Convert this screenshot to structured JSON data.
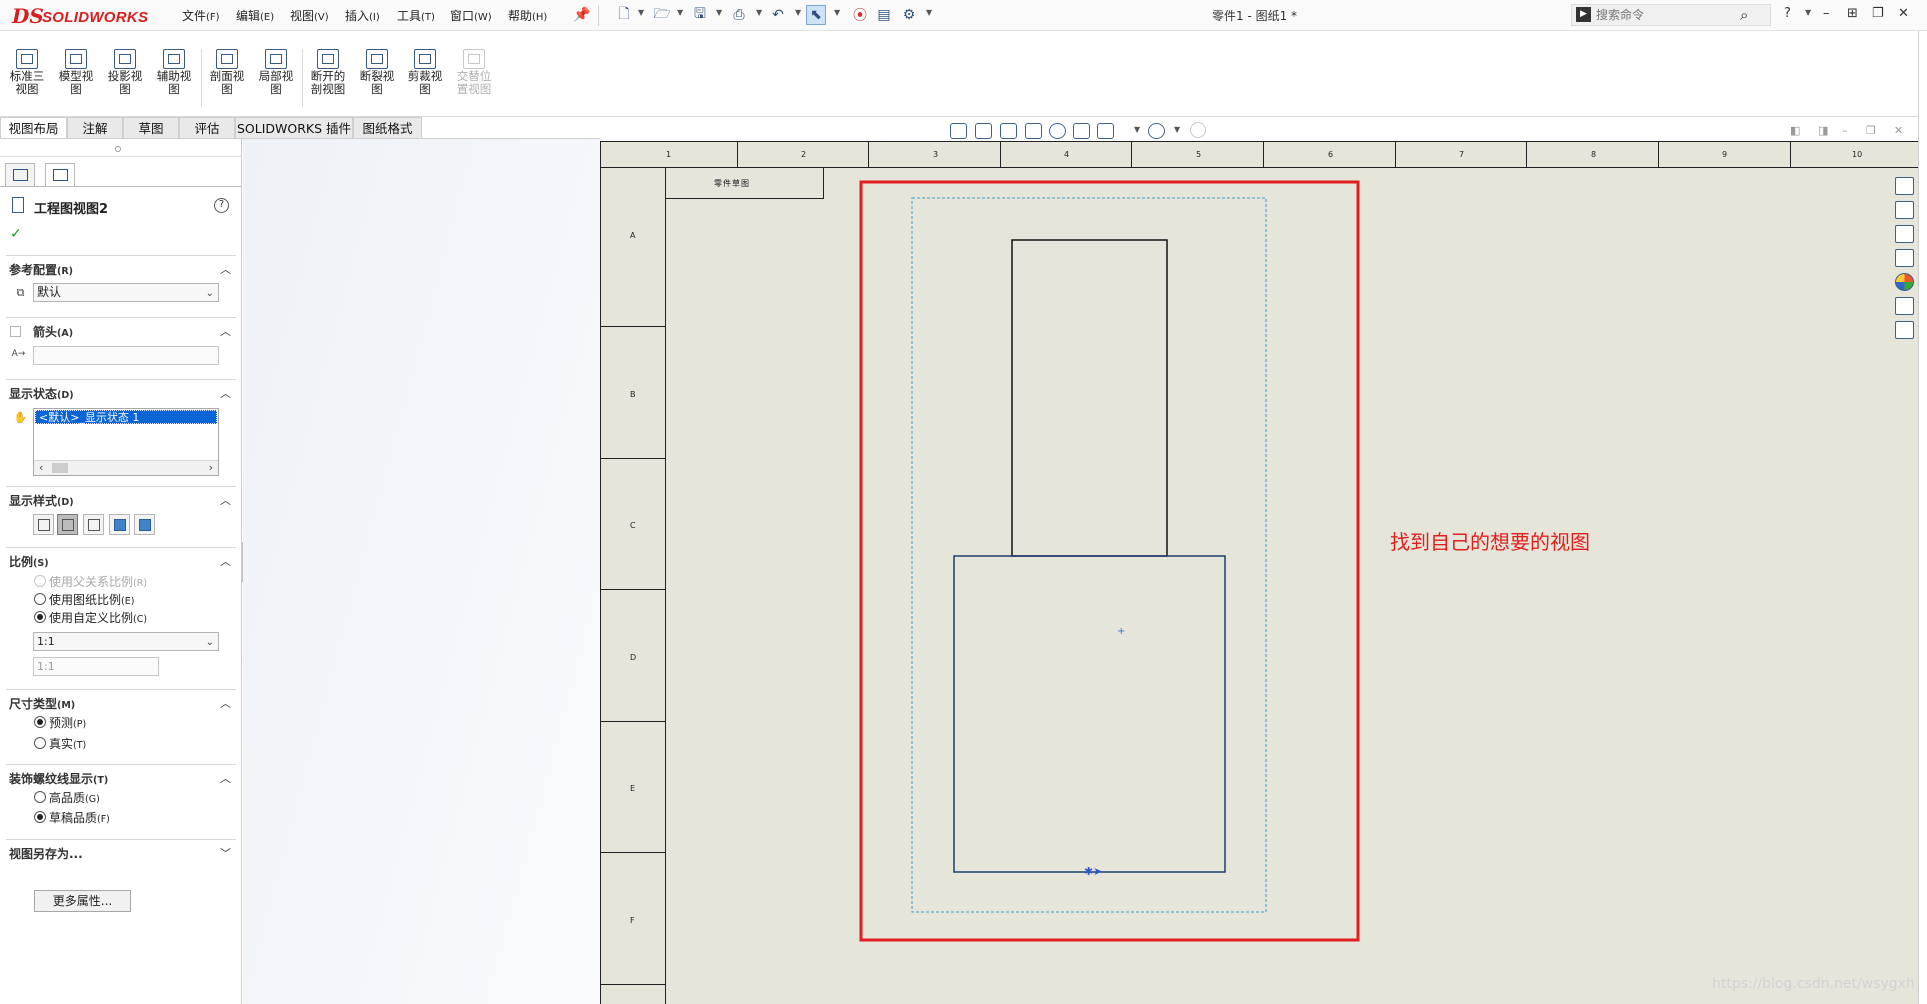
{
  "app": {
    "brand_ds": "DS",
    "brand_name": "SOLIDWORKS",
    "document_title": "零件1 - 图纸1 *"
  },
  "menu": {
    "items": [
      {
        "label": "文件",
        "key": "(F)"
      },
      {
        "label": "编辑",
        "key": "(E)"
      },
      {
        "label": "视图",
        "key": "(V)"
      },
      {
        "label": "插入",
        "key": "(I)"
      },
      {
        "label": "工具",
        "key": "(T)"
      },
      {
        "label": "窗口",
        "key": "(W)"
      },
      {
        "label": "帮助",
        "key": "(H)"
      }
    ]
  },
  "search": {
    "placeholder": "搜索命令"
  },
  "command_manager": {
    "buttons": [
      {
        "line1": "标准三",
        "line2": "视图",
        "enabled": true
      },
      {
        "line1": "模型视",
        "line2": "图",
        "enabled": true
      },
      {
        "line1": "投影视",
        "line2": "图",
        "enabled": true
      },
      {
        "line1": "辅助视",
        "line2": "图",
        "enabled": true
      },
      {
        "line1": "剖面视",
        "line2": "图",
        "enabled": true
      },
      {
        "line1": "局部视",
        "line2": "图",
        "enabled": true
      },
      {
        "line1": "断开的",
        "line2": "剖视图",
        "enabled": true
      },
      {
        "line1": "断裂视",
        "line2": "图",
        "enabled": true
      },
      {
        "line1": "剪裁视",
        "line2": "图",
        "enabled": true
      },
      {
        "line1": "交替位",
        "line2": "置视图",
        "enabled": false
      }
    ]
  },
  "tabs": [
    {
      "label": "视图布局",
      "active": true
    },
    {
      "label": "注解",
      "active": false
    },
    {
      "label": "草图",
      "active": false
    },
    {
      "label": "评估",
      "active": false
    },
    {
      "label": "SOLIDWORKS 插件",
      "active": false
    },
    {
      "label": "图纸格式",
      "active": false
    }
  ],
  "property_manager": {
    "title": "工程图视图2",
    "help": "?",
    "ok": "✓",
    "reference_config": {
      "title": "参考配置",
      "key": "(R)",
      "value": "默认"
    },
    "arrow": {
      "title": "箭头",
      "key": "(A)",
      "checked": false,
      "label_value": ""
    },
    "display_state": {
      "title": "显示状态",
      "key": "(D)",
      "selected": "<默认>_显示状态 1"
    },
    "display_style": {
      "title": "显示样式",
      "key": "(D)"
    },
    "scale": {
      "title": "比例",
      "key": "(S)",
      "options": [
        {
          "label": "使用父关系比例",
          "key": "(R)",
          "selected": false,
          "enabled": false
        },
        {
          "label": "使用图纸比例",
          "key": "(E)",
          "selected": false,
          "enabled": true
        },
        {
          "label": "使用自定义比例",
          "key": "(C)",
          "selected": true,
          "enabled": true
        }
      ],
      "combo_value": "1:1",
      "field_value": "1:1"
    },
    "dimension_type": {
      "title": "尺寸类型",
      "key": "(M)",
      "options": [
        {
          "label": "预测",
          "key": "(P)",
          "selected": true
        },
        {
          "label": "真实",
          "key": "(T)",
          "selected": false
        }
      ]
    },
    "cosmetic_thread": {
      "title": "装饰螺纹线显示",
      "key": "(T)",
      "options": [
        {
          "label": "高品质",
          "key": "(G)",
          "selected": false
        },
        {
          "label": "草稿品质",
          "key": "(F)",
          "selected": true
        }
      ]
    },
    "save_view_as": {
      "title": "视图另存为..."
    },
    "more_button": "更多属性..."
  },
  "sheet": {
    "zones_x": [
      "1",
      "2",
      "3",
      "4",
      "5",
      "6",
      "7",
      "8",
      "9",
      "10"
    ],
    "zones_y": [
      "A",
      "B",
      "C",
      "D",
      "E",
      "F"
    ],
    "view_label": "零件草图",
    "annotation_callout": "找到自己的想要的视图",
    "annotation_color": "#e21f1f",
    "sheet_color": "#e6e5da"
  },
  "watermark": "https://blog.csdn.net/wsygxh"
}
